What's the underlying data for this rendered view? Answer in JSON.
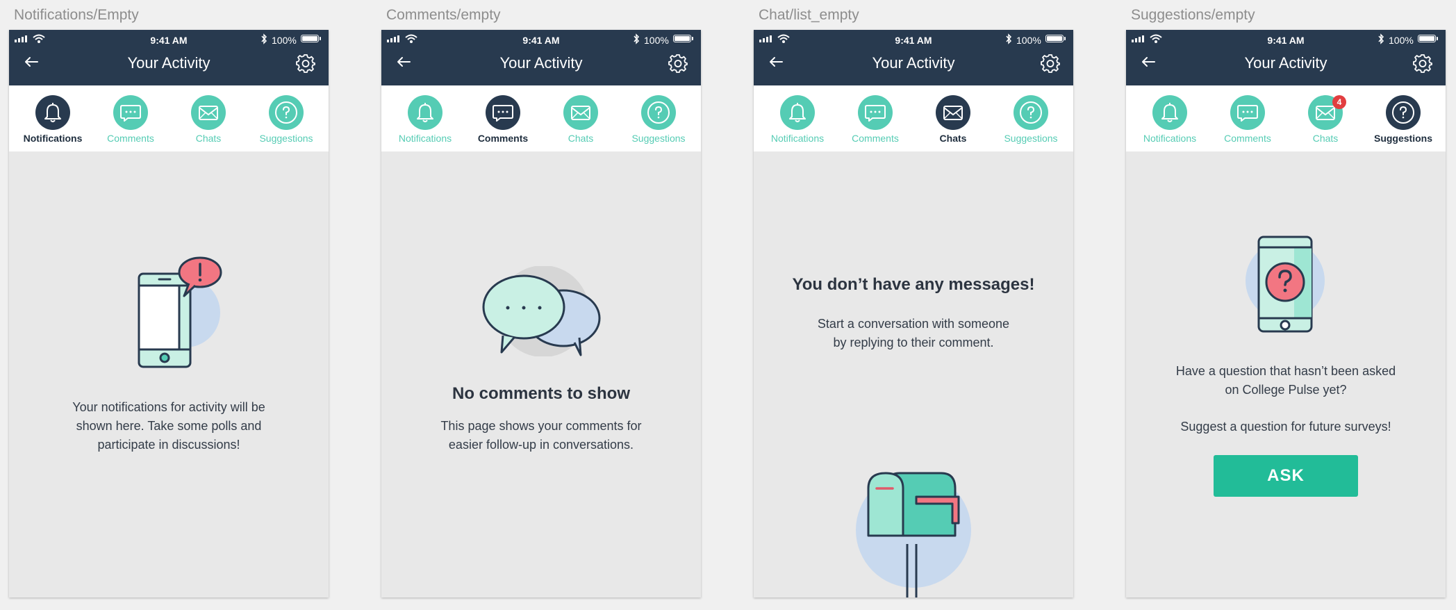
{
  "status_bar": {
    "time": "9:41 AM",
    "battery": "100%"
  },
  "header": {
    "title": "Your Activity"
  },
  "tab_labels": {
    "notifications": "Notifications",
    "comments": "Comments",
    "chats": "Chats",
    "suggestions": "Suggestions"
  },
  "colors": {
    "header": "#283a4f",
    "accent": "#55ccb4",
    "button": "#22bc98",
    "badge": "#e23e40",
    "pink": "#f27682"
  },
  "icons": {
    "back": "back-arrow-icon",
    "settings": "gear-icon",
    "notifications": "bell-icon",
    "comments": "comment-bubble-icon",
    "chats": "envelope-icon",
    "suggestions": "question-icon"
  },
  "screens": [
    {
      "artboard_title": "Notifications/Empty",
      "active_tab": "notifications",
      "message_lines": [
        "Your notifications for activity will be",
        "shown here. Take some polls and",
        "participate in discussions!"
      ]
    },
    {
      "artboard_title": "Comments/empty",
      "active_tab": "comments",
      "heading": "No comments to show",
      "message_lines": [
        "This page shows your comments for",
        "easier follow-up in conversations."
      ]
    },
    {
      "artboard_title": "Chat/list_empty",
      "active_tab": "chats",
      "heading": "You don’t have any messages!",
      "message_lines": [
        "Start a conversation with someone",
        "by replying to their comment."
      ]
    },
    {
      "artboard_title": "Suggestions/empty",
      "active_tab": "suggestions",
      "chat_badge": "4",
      "message_lines": [
        "Have a question that hasn’t been asked",
        "on College Pulse yet?"
      ],
      "message2": "Suggest a question for future surveys!",
      "button_label": "ASK"
    }
  ]
}
